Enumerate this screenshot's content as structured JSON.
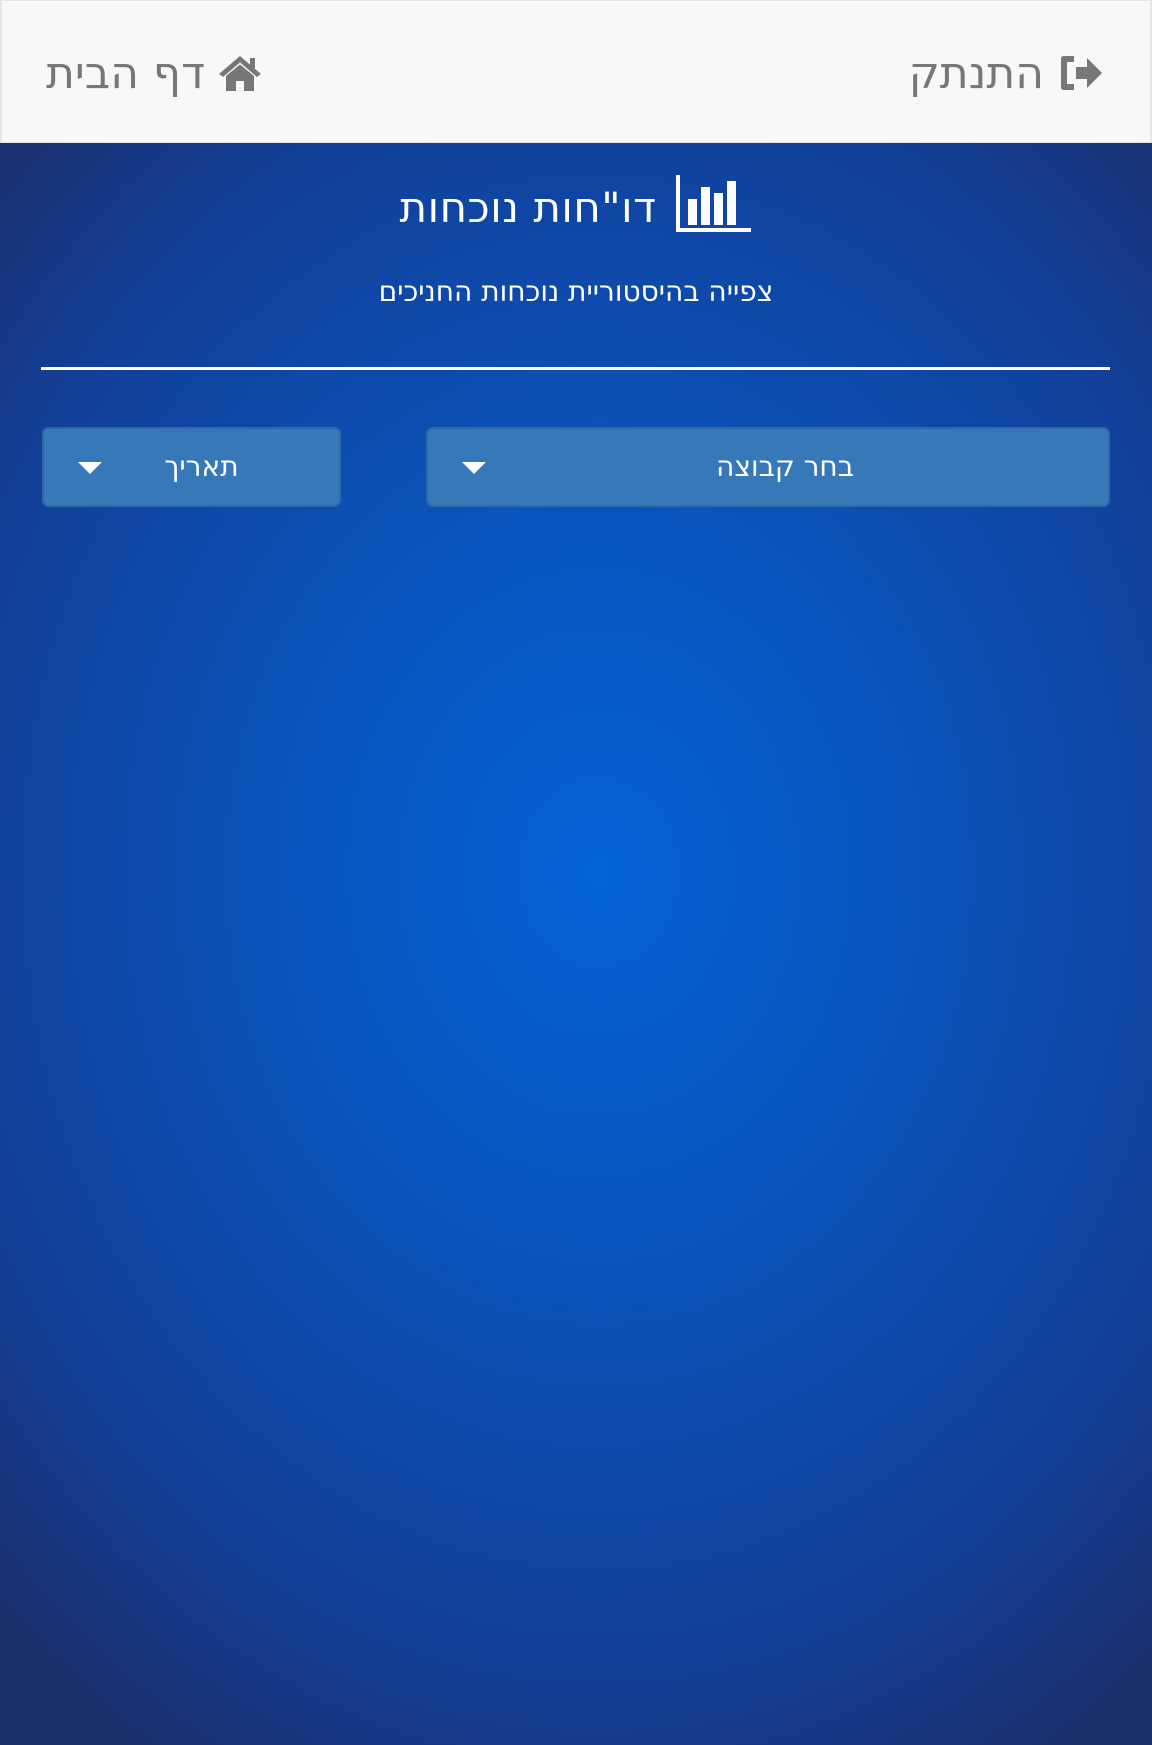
{
  "navbar": {
    "logout_label": "התנתק",
    "logout_icon": "sign-out-icon",
    "home_label": "דף הבית",
    "home_icon": "home-icon",
    "text_color": "#777777",
    "background": "#f8f8f8"
  },
  "header": {
    "title": "דו\"חות נוכחות",
    "title_icon": "bar-chart-icon",
    "subtitle": "צפייה בהיסטוריית נוכחות החניכים"
  },
  "filters": {
    "group_select": {
      "label": "בחר קבוצה",
      "icon": "caret-down-icon"
    },
    "date_select": {
      "label": "תאריך",
      "icon": "caret-down-icon"
    },
    "button_color": "#3778b9"
  },
  "colors": {
    "background_center": "#0463d9",
    "background_edge": "#1c2f6a",
    "text": "#ffffff"
  }
}
